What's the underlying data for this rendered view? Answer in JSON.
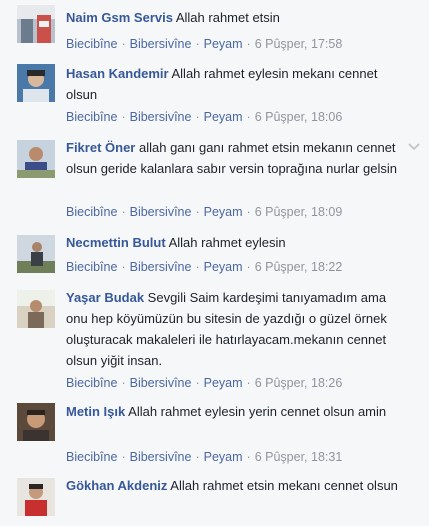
{
  "comments": [
    {
      "author": "Naim Gsm Servis",
      "text": "Allah rahmet etsin",
      "actions": {
        "like": "Biecibîne",
        "reply": "Bibersivîne",
        "message": "Peyam",
        "time": "6 Pûşper, 17:58"
      }
    },
    {
      "author": "Hasan Kandemir",
      "text": "Allah rahmet eylesin mekanı cennet olsun",
      "actions": {
        "like": "Biecibîne",
        "reply": "Bibersivîne",
        "message": "Peyam",
        "time": "6 Pûşper, 18:06"
      }
    },
    {
      "author": "Fikret Öner",
      "text": "allah ganı ganı rahmet etsin mekanın cennet olsun geride kalanlara sabır versin toprağına nurlar gelsin",
      "actions": {
        "like": "Biecibîne",
        "reply": "Bibersivîne",
        "message": "Peyam",
        "time": "6 Pûşper, 18:09"
      }
    },
    {
      "author": "Necmettin Bulut",
      "text": "Allah rahmet eylesin",
      "actions": {
        "like": "Biecibîne",
        "reply": "Bibersivîne",
        "message": "Peyam",
        "time": "6 Pûşper, 18:22"
      }
    },
    {
      "author": "Yaşar Budak",
      "text": "Sevgili Saim kardeşimi tanıyamadım ama onu hep köyümüzün bu sitesin de yazdığı o güzel örnek oluşturacak makaleleri ile hatırlayacam.mekanın cennet olsun yiğit insan.",
      "actions": {
        "like": "Biecibîne",
        "reply": "Bibersivîne",
        "message": "Peyam",
        "time": "6 Pûşper, 18:26"
      }
    },
    {
      "author": "Metin Işık",
      "text": "Allah rahmet eylesin yerin cennet olsun amin",
      "actions": {
        "like": "Biecibîne",
        "reply": "Bibersivîne",
        "message": "Peyam",
        "time": "6 Pûşper, 18:31"
      }
    },
    {
      "author": "Gökhan Akdeniz",
      "text": "Allah rahmet etsin mekanı cennet olsun",
      "actions": null
    }
  ],
  "separator": "·",
  "icons": {
    "options": "chevron-down-icon"
  },
  "colors": {
    "background": "#f6f7f9",
    "author": "#365899",
    "actions": "#4b67a1",
    "meta": "#90949c",
    "text": "#1d2129"
  }
}
